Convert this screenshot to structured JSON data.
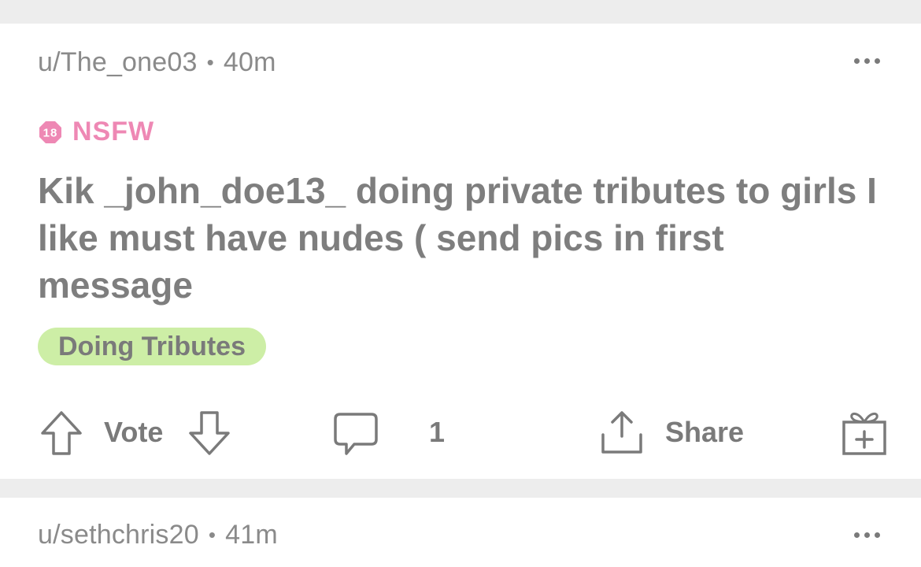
{
  "posts": [
    {
      "author": "u/The_one03",
      "separator": "•",
      "age": "40m",
      "nsfw_badge": "18",
      "nsfw_label": "NSFW",
      "title": "Kik _john_doe13_ doing private tributes to girls I like must have nudes ( send pics in first message",
      "flair": "Doing Tributes",
      "vote_label": "Vote",
      "comment_count": "1",
      "share_label": "Share"
    },
    {
      "author": "u/sethchris20",
      "separator": "•",
      "age": "41m"
    }
  ],
  "colors": {
    "nsfw": "#ee88b4",
    "flair_bg": "#cdeea6",
    "text": "#7e7e7e",
    "divider": "#ededed"
  },
  "icons": {
    "upvote": "arrow-up-icon",
    "downvote": "arrow-down-icon",
    "comment": "speech-bubble-icon",
    "share": "upload-icon",
    "award": "gift-icon",
    "more": "ellipsis-icon"
  }
}
